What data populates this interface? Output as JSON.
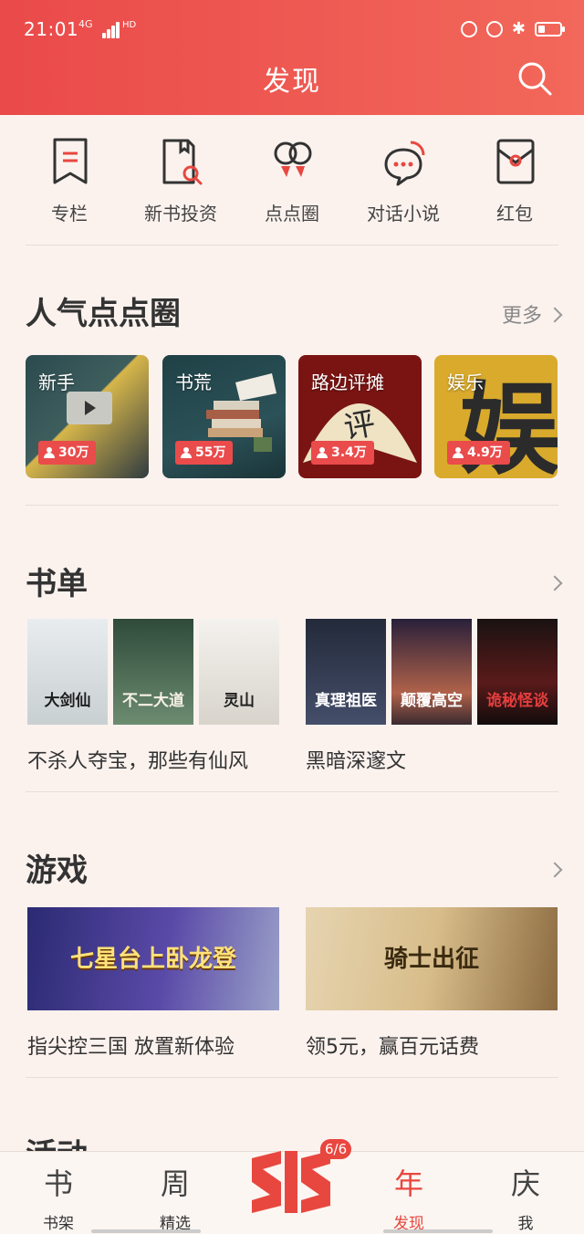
{
  "status_bar": {
    "time": "21:01",
    "network": "4G",
    "hd": "HD"
  },
  "header": {
    "title": "发现"
  },
  "quick_nav": [
    {
      "label": "专栏",
      "icon": "bookmark-icon"
    },
    {
      "label": "新书投资",
      "icon": "book-search-icon"
    },
    {
      "label": "点点圈",
      "icon": "bubble-circle-icon"
    },
    {
      "label": "对话小说",
      "icon": "chat-icon"
    },
    {
      "label": "红包",
      "icon": "red-envelope-icon"
    }
  ],
  "popular_circles": {
    "title": "人气点点圈",
    "more": "更多",
    "items": [
      {
        "name": "新手",
        "count": "30万"
      },
      {
        "name": "书荒",
        "count": "55万"
      },
      {
        "name": "路边评摊",
        "count": "3.4万"
      },
      {
        "name": "娱乐",
        "count": "4.9万"
      }
    ]
  },
  "booklists": {
    "title": "书单",
    "lists": [
      {
        "title": "不杀人夺宝，那些有仙风",
        "covers": [
          "大剑仙",
          "不二大道",
          "灵山"
        ]
      },
      {
        "title": "黑暗深邃文",
        "covers": [
          "真理祖医",
          "颠覆高空",
          "诡秘怪谈"
        ]
      }
    ]
  },
  "games": {
    "title": "游戏",
    "items": [
      {
        "title": "指尖控三国 放置新体验",
        "banner_text": "七星台上卧龙登"
      },
      {
        "title": "领5元，赢百元话费",
        "banner_text": "骑士出征"
      }
    ]
  },
  "next_section": {
    "title": "活动"
  },
  "tabbar": {
    "badge": "6/6",
    "tabs": [
      {
        "label": "书架",
        "glyph": "书"
      },
      {
        "label": "精选",
        "glyph": "周"
      },
      {
        "label": "发现",
        "glyph": "年"
      },
      {
        "label": "我",
        "glyph": "庆"
      }
    ]
  },
  "colors": {
    "accent": "#e8473f",
    "header_start": "#ea4a4a",
    "header_end": "#f2685a",
    "background": "#fbf2ee"
  }
}
